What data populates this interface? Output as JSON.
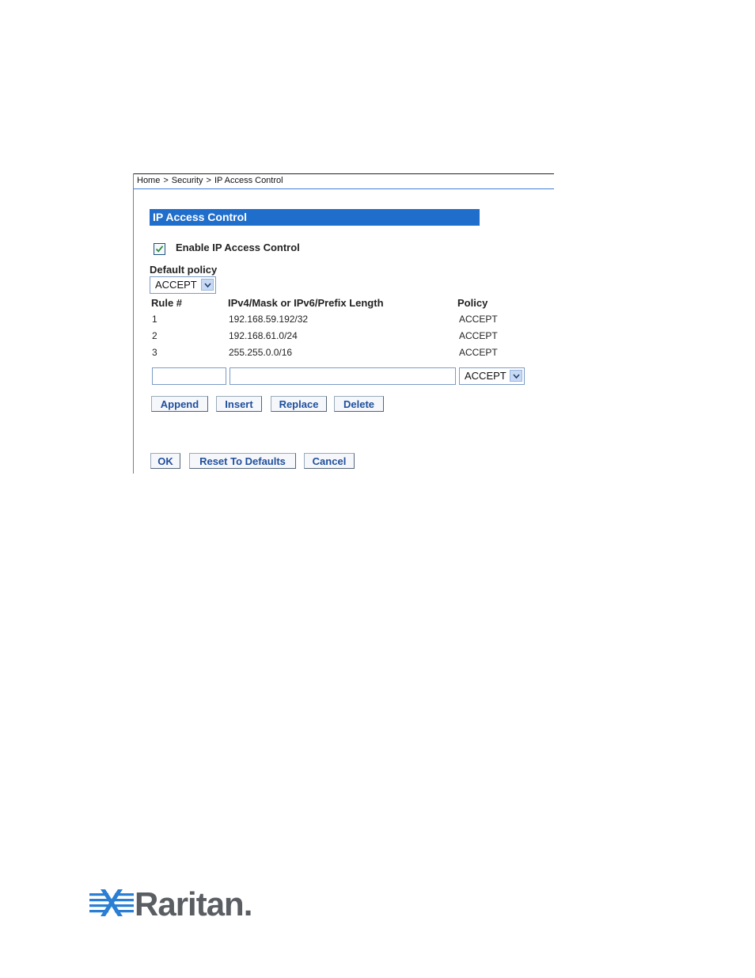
{
  "breadcrumb": {
    "items": [
      "Home",
      "Security",
      "IP Access Control"
    ],
    "separator": ">"
  },
  "section": {
    "title": "IP Access Control"
  },
  "enable": {
    "label": "Enable IP Access Control",
    "checked": true
  },
  "default_policy": {
    "label": "Default policy",
    "value": "ACCEPT"
  },
  "table": {
    "headers": {
      "rule": "Rule #",
      "mask": "IPv4/Mask or IPv6/Prefix Length",
      "policy": "Policy"
    },
    "rows": [
      {
        "rule": "1",
        "mask": "192.168.59.192/32",
        "policy": "ACCEPT"
      },
      {
        "rule": "2",
        "mask": "192.168.61.0/24",
        "policy": "ACCEPT"
      },
      {
        "rule": "3",
        "mask": "255.255.0.0/16",
        "policy": "ACCEPT"
      }
    ]
  },
  "new_rule": {
    "rule_value": "",
    "mask_value": "",
    "policy_value": "ACCEPT"
  },
  "rule_buttons": {
    "append": "Append",
    "insert": "Insert",
    "replace": "Replace",
    "delete": "Delete"
  },
  "form_buttons": {
    "ok": "OK",
    "reset": "Reset To Defaults",
    "cancel": "Cancel"
  },
  "logo": {
    "text": "Raritan",
    "suffix": "."
  },
  "colors": {
    "accent": "#1f6ecb",
    "button_text": "#1f4f9c",
    "logo_blue": "#2a7fd4",
    "logo_gray": "#5a5e63"
  }
}
